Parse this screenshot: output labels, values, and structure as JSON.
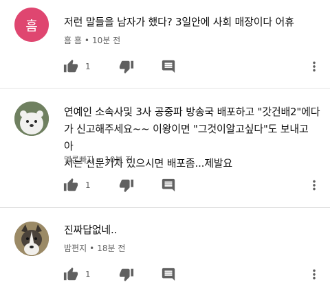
{
  "colors": {
    "avatar_heum": "#df4670",
    "text": "#0f0f0f",
    "meta": "#606060",
    "icon": "#606060"
  },
  "comments": [
    {
      "avatar_letter": "흠",
      "text_lines": [
        "저런 말들을 남자가 했다? 3일안에 사회 매장이다 어휴"
      ],
      "author": "흠 흠",
      "time": "10분 전",
      "likes": "1"
    },
    {
      "avatar_letter": "",
      "text_lines": [
        "연예인 소속사및 3사 공중파 방송국 배포하고 \"갓건배2\"에다",
        "가 신고해주세요~~ 이왕이면 \"그것이알고싶다\"도 보내고 아",
        "시는 신문기자 있으시면 배포좀...제발요"
      ],
      "author": "멜론빠자",
      "time": "10분 전",
      "likes": "1"
    },
    {
      "avatar_letter": "",
      "text_lines": [
        "진짜답없네.."
      ],
      "author": "밤편지",
      "time": "18분 전",
      "likes": "1"
    }
  ],
  "icons": {
    "like": "thumbs-up-icon",
    "dislike": "thumbs-down-icon",
    "reply": "reply-comment-icon",
    "more": "more-vert-icon"
  }
}
